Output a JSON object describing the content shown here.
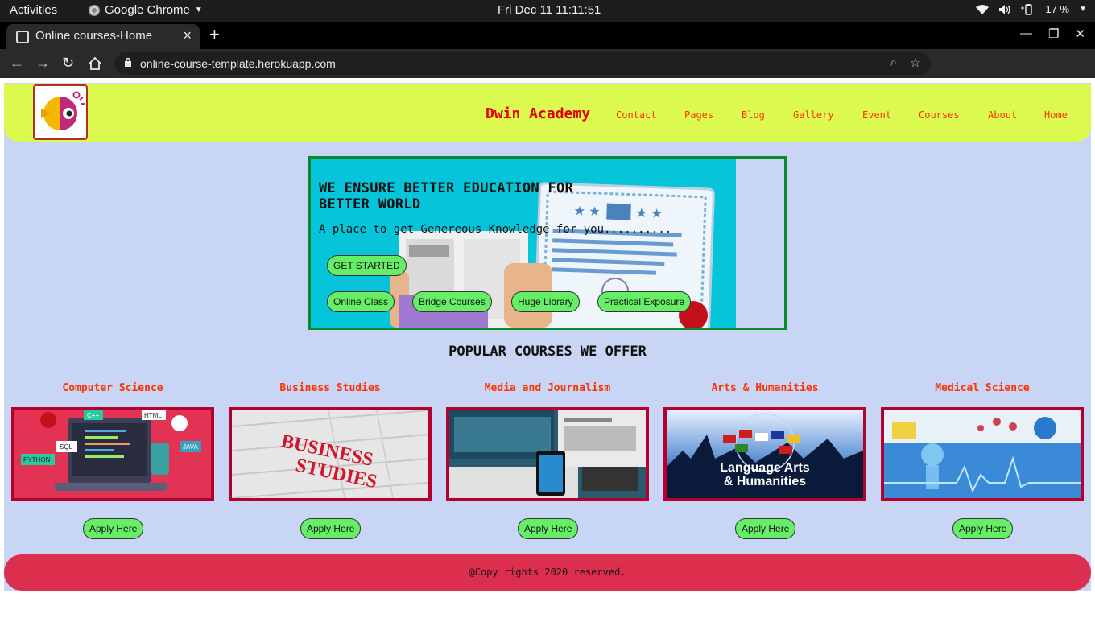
{
  "system_bar": {
    "activities": "Activities",
    "app_name": "Google Chrome",
    "clock": "Fri Dec 11  11:11:51",
    "battery": "17 %"
  },
  "browser": {
    "tab_title": "Online courses-Home",
    "url": "online-course-template.herokuapp.com"
  },
  "header": {
    "brand": "Dwin Academy",
    "nav": [
      "Contact",
      "Pages",
      "Blog",
      "Gallery",
      "Event",
      "Courses",
      "About",
      "Home"
    ]
  },
  "hero": {
    "headline": "WE ENSURE BETTER EDUCATION FOR BETTER WORLD",
    "subtitle": "A place to get Genereous Knowledge for you..........",
    "cta": "GET STARTED",
    "features": [
      "Online Class",
      "Bridge Courses",
      "Huge Library",
      "Practical Exposure"
    ]
  },
  "courses_section": {
    "title": "POPULAR COURSES WE OFFER",
    "apply_label": "Apply Here",
    "items": [
      {
        "name": "Computer Science",
        "image_text": [
          "C++",
          "HTML",
          "SQL",
          "JAVA",
          "PYTHON"
        ]
      },
      {
        "name": "Business Studies",
        "image_text": [
          "BUSINESS",
          "STUDIES"
        ]
      },
      {
        "name": "Media and Journalism"
      },
      {
        "name": "Arts & Humanities",
        "image_text": [
          "Language Arts",
          "& Humanities"
        ]
      },
      {
        "name": "Medical Science"
      }
    ]
  },
  "footer": {
    "copyright": "@Copy rights 2020 reserved."
  },
  "colors": {
    "page_bg": "#c8d5f5",
    "header_bg": "#dbf94f",
    "nav_text": "#ff3300",
    "brand_text": "#e60000",
    "button_green": "#66ee66",
    "footer_bg": "#dc2f4e",
    "card_border": "#b3002d",
    "hero_border": "#0a8a2a"
  }
}
